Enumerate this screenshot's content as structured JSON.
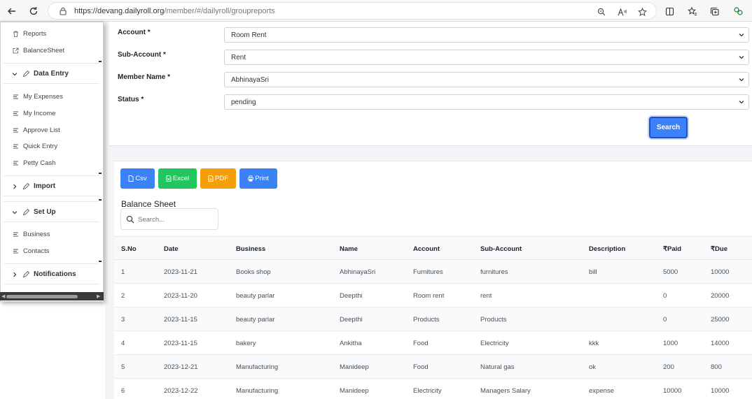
{
  "browser": {
    "url_host": "https://devang.dailyroll.org",
    "url_path": "/member/#/dailyroll/groupreports"
  },
  "sidebar": {
    "items_top": [
      {
        "label": "Reports",
        "icon": "trash-icon"
      },
      {
        "label": "BalanceSheet",
        "icon": "external-link-icon"
      }
    ],
    "data_entry": {
      "title": "Data Entry",
      "items": [
        "My Expenses",
        "My Income",
        "Approve List",
        "Quick Entry",
        "Petty Cash"
      ]
    },
    "import": {
      "title": "Import"
    },
    "setup": {
      "title": "Set Up",
      "items": [
        "Business",
        "Contacts"
      ]
    },
    "notifications": {
      "title": "Notifications"
    }
  },
  "form": {
    "account": {
      "label": "Account *",
      "value": "Room Rent"
    },
    "sub_account": {
      "label": "Sub-Account *",
      "value": "Rent"
    },
    "member": {
      "label": "Member Name *",
      "value": "AbhinayaSri"
    },
    "status": {
      "label": "Status *",
      "value": "pending"
    },
    "search_label": "Search"
  },
  "export": {
    "csv": "Csv",
    "excel": "Excel",
    "pdf": "PDF",
    "print": "Print",
    "colors": {
      "csv": "#3b82f6",
      "excel": "#22c55e",
      "pdf": "#f59e0b",
      "print": "#3b82f6"
    }
  },
  "report": {
    "title": "Balance Sheet",
    "search_placeholder": "Search...",
    "columns": [
      "S.No",
      "Date",
      "Business",
      "Name",
      "Account",
      "Sub-Account",
      "Description",
      "₹Paid",
      "₹Due"
    ],
    "rows": [
      [
        "1",
        "2023-11-21",
        "Books shop",
        "AbhinayaSri",
        "Furnitures",
        "furnitures",
        "bill",
        "5000",
        "10000"
      ],
      [
        "2",
        "2023-11-20",
        "beauty parlar",
        "Deepthi",
        "Room rent",
        "rent",
        "",
        "0",
        "20000"
      ],
      [
        "3",
        "2023-11-15",
        "beauty parlar",
        "Deepthi",
        "Products",
        "Products",
        "",
        "0",
        "25000"
      ],
      [
        "4",
        "2023-11-15",
        "bakery",
        "Ankitha",
        "Food",
        "Electricity",
        "kkk",
        "1000",
        "14000"
      ],
      [
        "5",
        "2023-12-21",
        "Manufacturing",
        "Manideep",
        "Food",
        "Natural gas",
        "ok",
        "200",
        "800"
      ],
      [
        "6",
        "2023-12-22",
        "Manufacturing",
        "Manideep",
        "Electricity",
        "Managers Salary",
        "expense",
        "10000",
        "10000"
      ]
    ]
  }
}
